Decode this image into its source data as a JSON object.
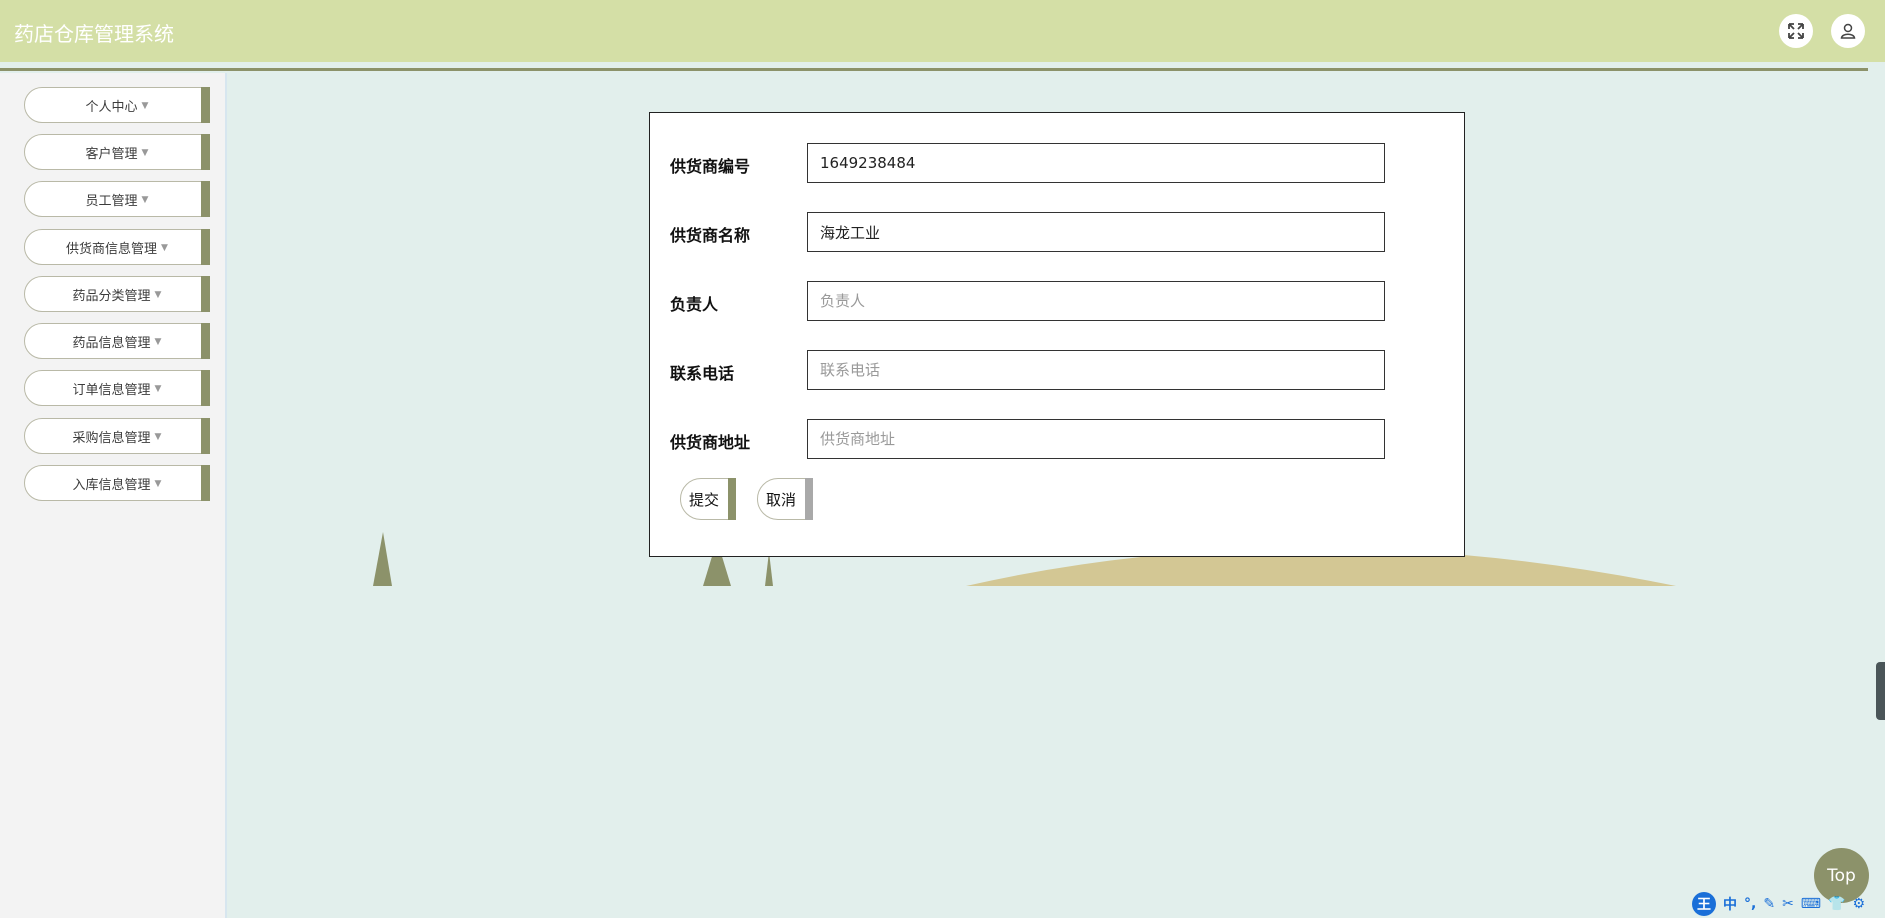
{
  "header": {
    "title": "药店仓库管理系统",
    "fullscreen_icon": "expand-icon",
    "user_icon": "user-icon"
  },
  "sidebar": {
    "items": [
      {
        "label": "个人中心"
      },
      {
        "label": "客户管理"
      },
      {
        "label": "员工管理"
      },
      {
        "label": "供货商信息管理"
      },
      {
        "label": "药品分类管理"
      },
      {
        "label": "药品信息管理"
      },
      {
        "label": "订单信息管理"
      },
      {
        "label": "采购信息管理"
      },
      {
        "label": "入库信息管理"
      }
    ]
  },
  "form": {
    "supplier_no": {
      "label": "供货商编号",
      "value": "1649238484"
    },
    "supplier_name": {
      "label": "供货商名称",
      "value": "海龙工业"
    },
    "contact_person": {
      "label": "负责人",
      "value": "",
      "placeholder": "负责人"
    },
    "phone": {
      "label": "联系电话",
      "value": "",
      "placeholder": "联系电话"
    },
    "address": {
      "label": "供货商地址",
      "value": "",
      "placeholder": "供货商地址"
    },
    "submit_label": "提交",
    "cancel_label": "取消"
  },
  "top_button_label": "Top",
  "ime": {
    "logo": "王",
    "items": [
      "中",
      "°,",
      "✎",
      "✂",
      "⌨",
      "👕",
      "⚙"
    ]
  },
  "colors": {
    "header_bg": "#d4dfa6",
    "accent": "#8c926a",
    "page_bg": "#e2efec",
    "hill": "#d3c794"
  }
}
